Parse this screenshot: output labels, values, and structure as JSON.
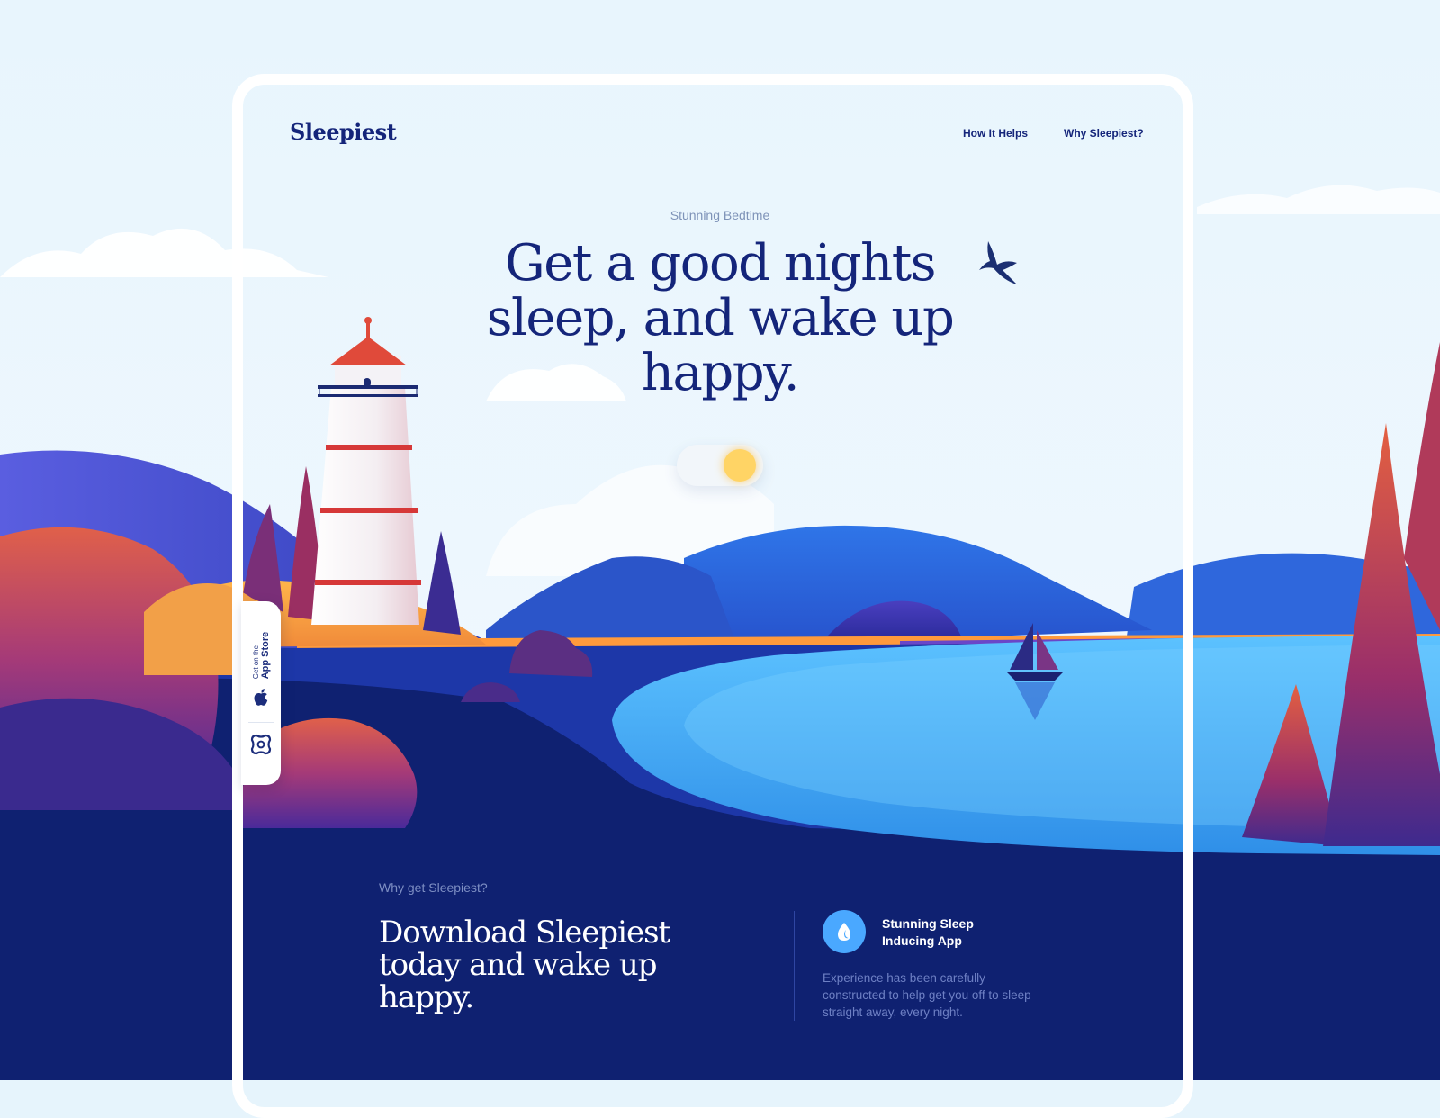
{
  "brand": {
    "logo": "Sleepiest"
  },
  "nav": {
    "items": [
      "How It Helps",
      "Why Sleepiest?"
    ]
  },
  "hero": {
    "eyebrow": "Stunning Bedtime",
    "headline": "Get a good nights sleep, and wake up happy.",
    "toggle": {
      "state": "day",
      "icon": "sun-icon"
    }
  },
  "side_badge": {
    "small": "Get on the",
    "big": "App Store",
    "store_icon": "apple-icon",
    "app_icon": "app-logo-icon"
  },
  "section": {
    "eyebrow": "Why get Sleepiest?",
    "title": "Download Sleepiest today and wake up happy.",
    "feature": {
      "icon": "moon-drop-icon",
      "title": "Stunning Sleep Inducing App",
      "description": "Experience has been carefully constructed to help get you off to sleep straight away, every night."
    }
  },
  "colors": {
    "sky": "#e6f4fc",
    "navy": "#0f2171",
    "brand_text": "#14257a",
    "accent_blue": "#4aa8ff",
    "sun": "#ffd465",
    "lighthouse_red": "#d63838"
  }
}
